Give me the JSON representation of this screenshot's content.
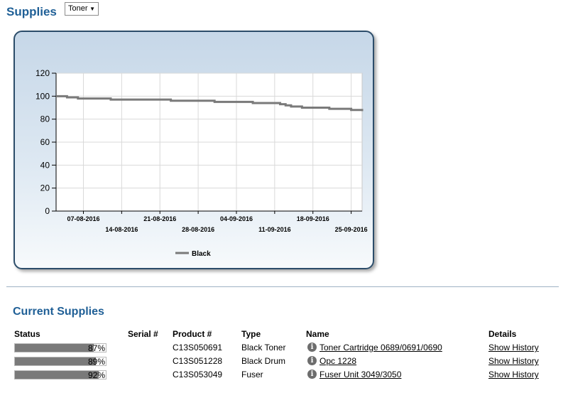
{
  "header": {
    "title": "Supplies",
    "type_select_value": "Toner"
  },
  "chart_data": {
    "type": "line",
    "title": "",
    "xlabel": "",
    "ylabel": "",
    "ylim": [
      0,
      120
    ],
    "y_ticks": [
      0,
      20,
      40,
      60,
      80,
      100,
      120
    ],
    "x_range": [
      "2016-08-02",
      "2016-09-27"
    ],
    "x_ticks": [
      "07-08-2016",
      "14-08-2016",
      "21-08-2016",
      "28-08-2016",
      "04-09-2016",
      "11-09-2016",
      "18-09-2016",
      "25-09-2016"
    ],
    "grid": true,
    "legend_position": "bottom",
    "series": [
      {
        "name": "Black",
        "color": "#7a7a7a",
        "x": [
          "2016-08-02",
          "2016-08-04",
          "2016-08-06",
          "2016-08-10",
          "2016-08-12",
          "2016-08-20",
          "2016-08-22",
          "2016-08-23",
          "2016-08-24",
          "2016-08-29",
          "2016-08-31",
          "2016-09-07",
          "2016-09-10",
          "2016-09-12",
          "2016-09-13",
          "2016-09-14",
          "2016-09-16",
          "2016-09-21",
          "2016-09-25",
          "2016-09-27"
        ],
        "values": [
          100,
          99,
          98,
          98,
          97,
          97,
          97,
          96,
          96,
          96,
          95,
          94,
          94,
          93,
          92,
          91,
          90,
          89,
          88,
          87
        ]
      }
    ]
  },
  "current_supplies": {
    "title": "Current Supplies",
    "columns": {
      "status": "Status",
      "serial": "Serial #",
      "product": "Product #",
      "type": "Type",
      "name": "Name",
      "details": "Details"
    },
    "rows": [
      {
        "status_pct": 87,
        "status_label": "87%",
        "serial": "",
        "product": "C13S050691",
        "type": "Black Toner",
        "name": "Toner Cartridge 0689/0691/0690",
        "details": "Show History"
      },
      {
        "status_pct": 89,
        "status_label": "89%",
        "serial": "",
        "product": "C13S051228",
        "type": "Black Drum",
        "name": "Opc 1228",
        "details": "Show History"
      },
      {
        "status_pct": 92,
        "status_label": "92%",
        "serial": "",
        "product": "C13S053049",
        "type": "Fuser",
        "name": "Fuser Unit 3049/3050",
        "details": "Show History"
      }
    ]
  }
}
